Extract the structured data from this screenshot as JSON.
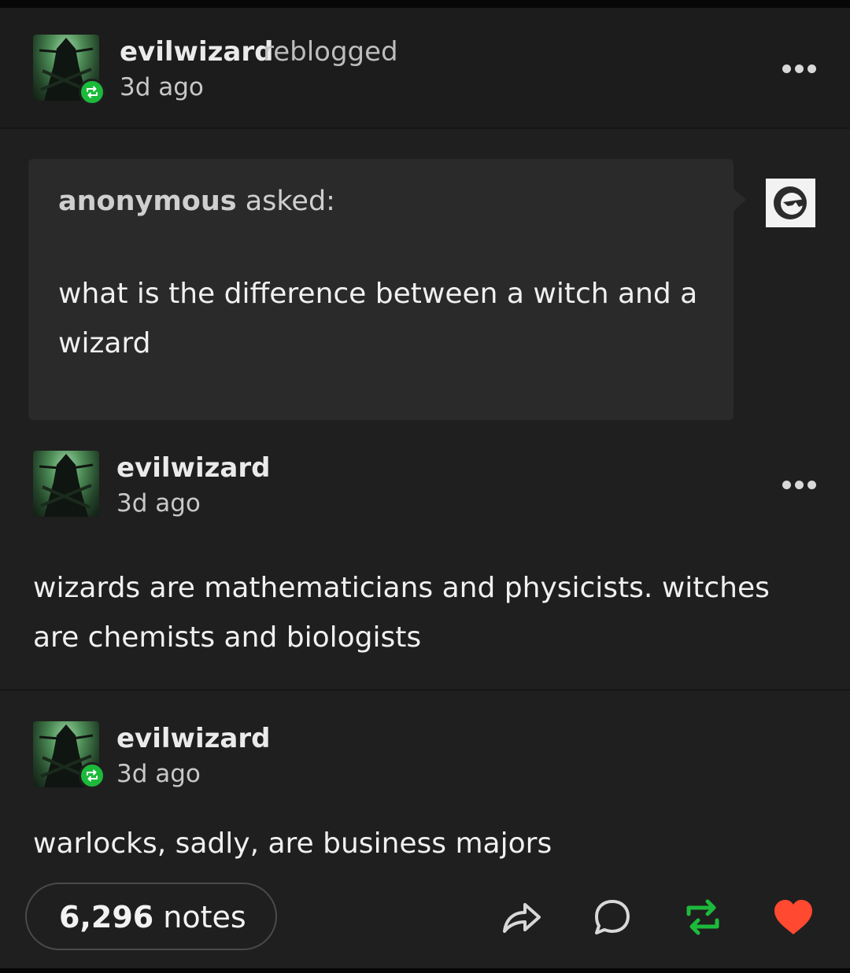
{
  "reblog_header": {
    "username": "evilwizard",
    "action": "reblogged",
    "time": "3d ago"
  },
  "ask": {
    "asker": "anonymous",
    "asked_label": "asked:",
    "question": "what is the difference between a witch and a wizard"
  },
  "answer": {
    "username": "evilwizard",
    "time": "3d ago",
    "text": "wizards are mathematicians and physicists. witches are chemists and biologists"
  },
  "addition": {
    "username": "evilwizard",
    "time": "3d ago",
    "text": "warlocks, sadly, are business majors"
  },
  "footer": {
    "notes_count": "6,296",
    "notes_label": "notes"
  },
  "icons": [
    "reblog-badge-icon",
    "more-options-icon",
    "share-icon",
    "reply-icon",
    "reblog-icon",
    "like-heart-icon"
  ],
  "colors": {
    "background": "#1f1f1f",
    "reblog_green": "#1cba3b",
    "like_red": "#ff4930",
    "ask_bubble": "#2a2a2a"
  }
}
